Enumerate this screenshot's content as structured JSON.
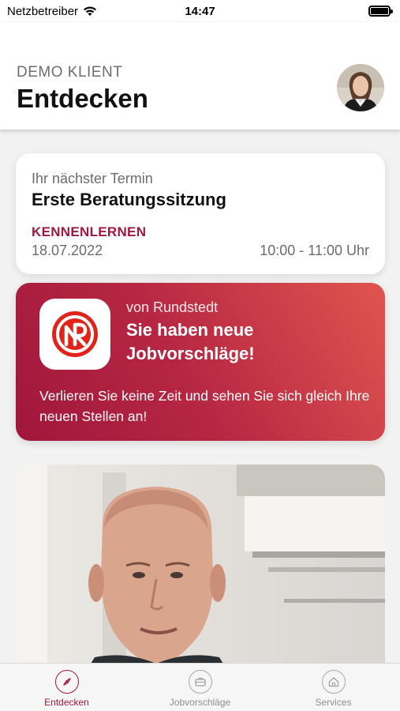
{
  "status_bar": {
    "carrier": "Netzbetreiber",
    "time": "14:47"
  },
  "header": {
    "subtitle": "DEMO KLIENT",
    "title": "Entdecken"
  },
  "appointment": {
    "label": "Ihr nächster Termin",
    "title": "Erste Beratungssitzung",
    "type": "KENNENLERNEN",
    "date": "18.07.2022",
    "time": "10:00 - 11:00 Uhr"
  },
  "jobs_card": {
    "brand": "von Rundstedt",
    "title_line1": "Sie haben neue",
    "title_line2": "Jobvorschläge!",
    "text": "Verlieren Sie keine Zeit und sehen Sie sich gleich Ihre neuen Stellen an!"
  },
  "tabs": [
    {
      "label": "Entdecken",
      "icon": "compass-icon",
      "active": true
    },
    {
      "label": "Jobvorschläge",
      "icon": "briefcase-icon",
      "active": false
    },
    {
      "label": "Services",
      "icon": "home-icon",
      "active": false
    }
  ],
  "colors": {
    "accent": "#a3173c",
    "card_gradient_start": "#a0163b",
    "card_gradient_end": "#e0554f"
  }
}
